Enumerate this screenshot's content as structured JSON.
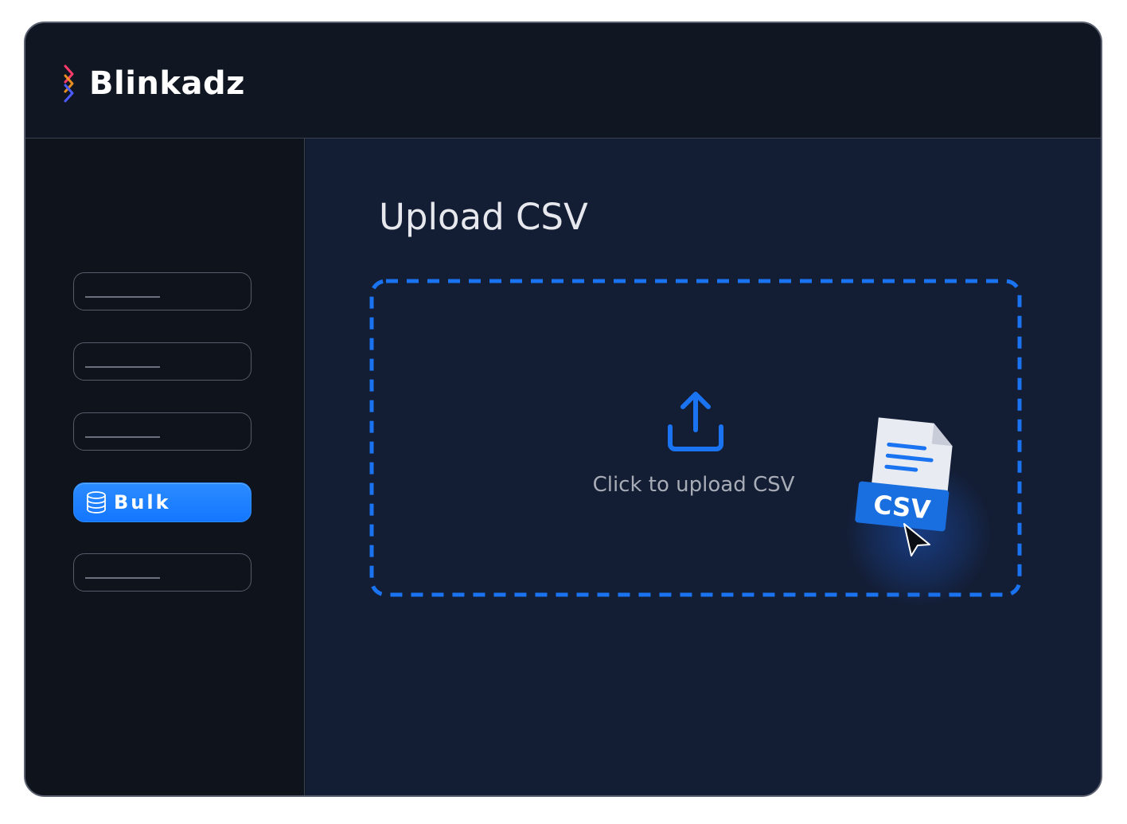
{
  "app": {
    "brand": "Blinkadz",
    "brand_colors": [
      "#ff3b6b",
      "#ff9a1f",
      "#5a3bff",
      "#2b6cff"
    ]
  },
  "sidebar": {
    "items": [
      {
        "label": "",
        "active": false
      },
      {
        "label": "",
        "active": false
      },
      {
        "label": "",
        "active": false
      },
      {
        "label": "Bulk",
        "active": true,
        "icon": "database-icon"
      },
      {
        "label": "",
        "active": false
      }
    ]
  },
  "main": {
    "title": "Upload CSV",
    "dropzone": {
      "text": "Click to upload CSV",
      "icon": "upload-icon",
      "file_badge": "CSV",
      "accent": "#1a73f0"
    }
  }
}
